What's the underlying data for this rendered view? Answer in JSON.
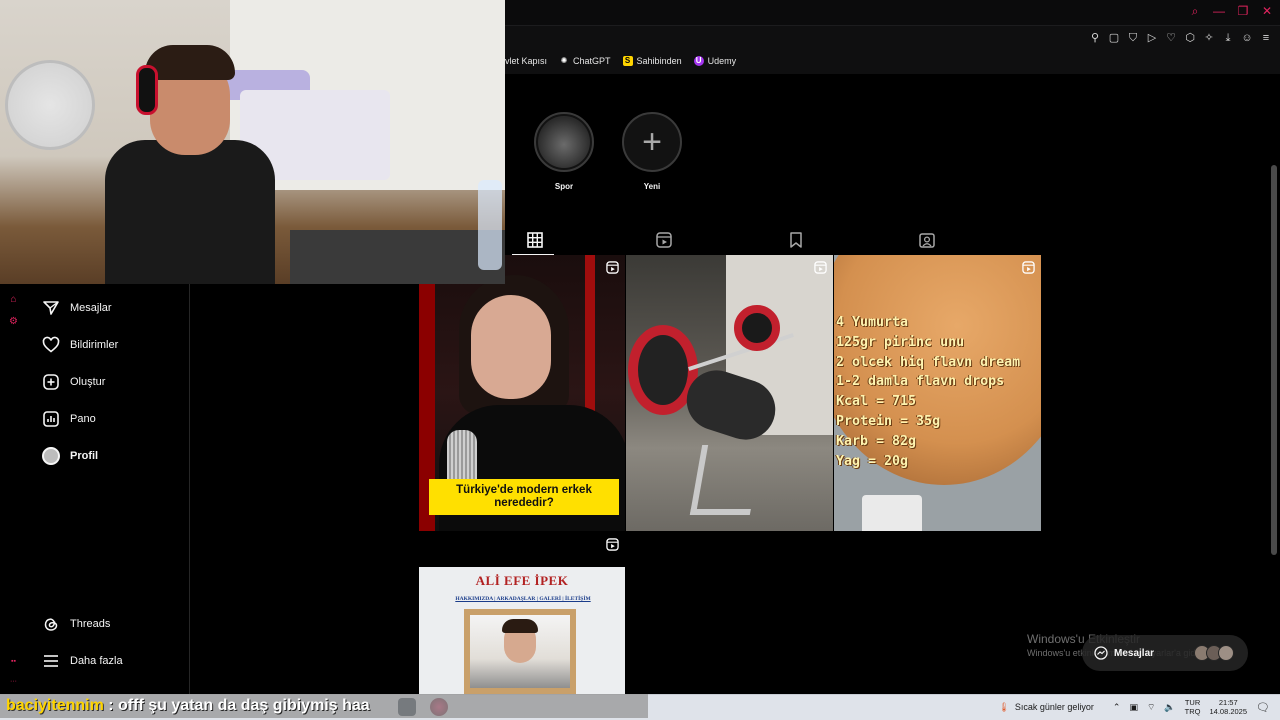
{
  "browser": {
    "bookmarks": [
      {
        "label": "evlet Kapısı",
        "icon": "bookmark-icon",
        "color": "#e6e6e6"
      },
      {
        "label": "ChatGPT",
        "icon": "chatgpt-icon",
        "color": "#ffffff"
      },
      {
        "label": "Sahibinden",
        "icon": "sahibinden-icon",
        "color": "#ffd400",
        "letter": "S"
      },
      {
        "label": "Udemy",
        "icon": "udemy-icon",
        "color": "#a435f0",
        "letter": "U"
      }
    ],
    "accent": "#e0245e"
  },
  "highlights": [
    {
      "label": "Spor"
    },
    {
      "label": "Yeni"
    }
  ],
  "profile_tabs": [
    "posts-grid-icon",
    "reels-icon",
    "saved-icon",
    "tagged-icon"
  ],
  "sidebar": {
    "items": [
      {
        "label": "Mesajlar",
        "icon": "messages-icon"
      },
      {
        "label": "Bildirimler",
        "icon": "heart-icon"
      },
      {
        "label": "Oluştur",
        "icon": "create-icon"
      },
      {
        "label": "Pano",
        "icon": "dashboard-icon"
      },
      {
        "label": "Profil",
        "icon": "avatar"
      }
    ],
    "bottom_items": [
      {
        "label": "Threads",
        "icon": "threads-icon"
      },
      {
        "label": "Daha fazla",
        "icon": "menu-icon"
      }
    ]
  },
  "posts": [
    {
      "caption": "Türkiye'de modern erkek nerededir?"
    },
    {
      "caption": ""
    },
    {
      "recipe_lines": [
        "4 Yumurta",
        "125gr pirinc unu",
        "2 olcek hiq flavn dream",
        "1-2 damla flavn drops",
        "Kcal = 715",
        "Protein = 35g",
        "Karb = 82g",
        "Yag = 20g"
      ]
    },
    {
      "name": "ALİ EFE İPEK",
      "menu": "HAKKIMIZDA | ARKADAŞLAR | GALERİ | İLETİŞİM"
    }
  ],
  "watermark": {
    "title": "Windows'u Etkinleştir",
    "subtitle": "Windows'u etkinleştirmek için Ayarlar'a gidin."
  },
  "messages_pill": {
    "label": "Mesajlar"
  },
  "chat": {
    "user": "baciyitennim",
    "message": " : offf şu yatan da daş gibiymiş haa"
  },
  "taskbar": {
    "weather": "Sıcak günler geliyor",
    "lang_top": "TUR",
    "lang_bottom": "TRQ",
    "time": "21:57",
    "date": "14.08.2025"
  }
}
